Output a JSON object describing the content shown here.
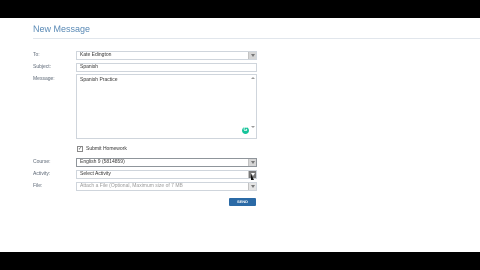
{
  "page_title": "New Message",
  "form": {
    "to": {
      "label": "To:",
      "value": "Kate Edington"
    },
    "subject": {
      "label": "Subject:",
      "value": "Spanish"
    },
    "message": {
      "label": "Message:",
      "value": "Spanish Practice"
    },
    "submit_homework": {
      "label": "Submit Homework",
      "checked": true,
      "mark": "✓"
    },
    "course": {
      "label": "Course:",
      "value": "English 9 (5814859)"
    },
    "activity": {
      "label": "Activity:",
      "value": "Select Activity"
    },
    "file": {
      "label": "File:",
      "placeholder": "Attach a File (Optional, Maximum size of 7 MB"
    },
    "send_label": "SEND",
    "grammarly_glyph": "G"
  },
  "colors": {
    "title": "#5a8ab6",
    "send_button": "#2b6aa6",
    "grammarly": "#15c39a"
  }
}
